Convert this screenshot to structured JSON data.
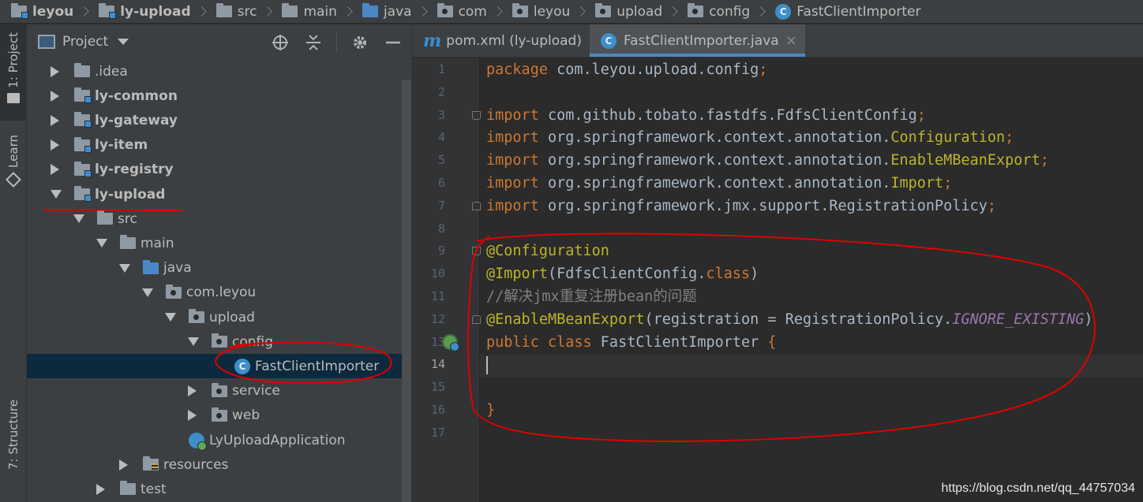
{
  "breadcrumb": [
    {
      "label": "leyou",
      "icon": "module-folder-icon",
      "bold": true
    },
    {
      "label": "ly-upload",
      "icon": "module-folder-icon",
      "bold": true
    },
    {
      "label": "src",
      "icon": "folder-icon",
      "bold": false
    },
    {
      "label": "main",
      "icon": "folder-icon",
      "bold": false
    },
    {
      "label": "java",
      "icon": "source-folder-icon",
      "bold": false
    },
    {
      "label": "com",
      "icon": "package-icon",
      "bold": false
    },
    {
      "label": "leyou",
      "icon": "package-icon",
      "bold": false
    },
    {
      "label": "upload",
      "icon": "package-icon",
      "bold": false
    },
    {
      "label": "config",
      "icon": "package-icon",
      "bold": false
    },
    {
      "label": "FastClientImporter",
      "icon": "class-icon",
      "bold": false
    }
  ],
  "left_strip": {
    "project_tab": "1: Project",
    "learn_tab": "Learn",
    "structure_tab": "7: Structure"
  },
  "project_panel": {
    "title": "Project",
    "tools": [
      "locate-icon",
      "collapse-all-icon",
      "gear-icon",
      "minimize-icon"
    ],
    "tree": [
      {
        "label": ".idea",
        "depth": 0,
        "expanded": false,
        "icon": "folder",
        "bold": false
      },
      {
        "label": "ly-common",
        "depth": 0,
        "expanded": false,
        "icon": "module",
        "bold": true
      },
      {
        "label": "ly-gateway",
        "depth": 0,
        "expanded": false,
        "icon": "module",
        "bold": true
      },
      {
        "label": "ly-item",
        "depth": 0,
        "expanded": false,
        "icon": "module",
        "bold": true
      },
      {
        "label": "ly-registry",
        "depth": 0,
        "expanded": false,
        "icon": "module",
        "bold": true
      },
      {
        "label": "ly-upload",
        "depth": 0,
        "expanded": true,
        "icon": "module",
        "bold": true
      },
      {
        "label": "src",
        "depth": 1,
        "expanded": true,
        "icon": "folder",
        "bold": false
      },
      {
        "label": "main",
        "depth": 2,
        "expanded": true,
        "icon": "folder",
        "bold": false
      },
      {
        "label": "java",
        "depth": 3,
        "expanded": true,
        "icon": "source",
        "bold": false
      },
      {
        "label": "com.leyou",
        "depth": 4,
        "expanded": true,
        "icon": "package",
        "bold": false
      },
      {
        "label": "upload",
        "depth": 5,
        "expanded": true,
        "icon": "package",
        "bold": false
      },
      {
        "label": "config",
        "depth": 6,
        "expanded": true,
        "icon": "package",
        "bold": false
      },
      {
        "label": "FastClientImporter",
        "depth": 7,
        "expanded": null,
        "icon": "class",
        "bold": false,
        "selected": true
      },
      {
        "label": "service",
        "depth": 6,
        "expanded": false,
        "icon": "package",
        "bold": false
      },
      {
        "label": "web",
        "depth": 6,
        "expanded": false,
        "icon": "package",
        "bold": false
      },
      {
        "label": "LyUploadApplication",
        "depth": 5,
        "expanded": null,
        "icon": "app",
        "bold": false
      },
      {
        "label": "resources",
        "depth": 3,
        "expanded": false,
        "icon": "resources",
        "bold": false
      },
      {
        "label": "test",
        "depth": 2,
        "expanded": false,
        "icon": "folder",
        "bold": false
      }
    ]
  },
  "editor": {
    "tabs": [
      {
        "label": "pom.xml (ly-upload)",
        "icon": "maven-icon",
        "active": false
      },
      {
        "label": "FastClientImporter.java",
        "icon": "class-icon",
        "active": true
      }
    ],
    "current_line": 14,
    "lines": [
      {
        "n": "1",
        "tokens": [
          [
            "kw",
            "package "
          ],
          [
            "",
            "com.leyou.upload.config"
          ],
          [
            "kw",
            ";"
          ]
        ]
      },
      {
        "n": "2",
        "tokens": []
      },
      {
        "n": "3",
        "tokens": [
          [
            "kw",
            "import "
          ],
          [
            "",
            "com.github.tobato.fastdfs.FdfsClientConfig"
          ],
          [
            "kw",
            ";"
          ]
        ]
      },
      {
        "n": "4",
        "tokens": [
          [
            "kw",
            "import "
          ],
          [
            "",
            "org.springframework.context.annotation."
          ],
          [
            "an",
            "Configuration"
          ],
          [
            "kw",
            ";"
          ]
        ]
      },
      {
        "n": "5",
        "tokens": [
          [
            "kw",
            "import "
          ],
          [
            "",
            "org.springframework.context.annotation."
          ],
          [
            "an",
            "EnableMBeanExport"
          ],
          [
            "kw",
            ";"
          ]
        ]
      },
      {
        "n": "6",
        "tokens": [
          [
            "kw",
            "import "
          ],
          [
            "",
            "org.springframework.context.annotation."
          ],
          [
            "an",
            "Import"
          ],
          [
            "kw",
            ";"
          ]
        ]
      },
      {
        "n": "7",
        "tokens": [
          [
            "kw",
            "import "
          ],
          [
            "",
            "org.springframework.jmx.support.RegistrationPolicy"
          ],
          [
            "kw",
            ";"
          ]
        ]
      },
      {
        "n": "8",
        "tokens": []
      },
      {
        "n": "9",
        "tokens": [
          [
            "an",
            "@Configuration"
          ]
        ]
      },
      {
        "n": "10",
        "tokens": [
          [
            "an",
            "@Import"
          ],
          [
            "",
            "(FdfsClientConfig."
          ],
          [
            "kw",
            "class"
          ],
          [
            "",
            ")"
          ]
        ]
      },
      {
        "n": "11",
        "tokens": [
          [
            "cm",
            "//解决jmx重复注册bean的问题"
          ]
        ]
      },
      {
        "n": "12",
        "tokens": [
          [
            "an",
            "@EnableMBeanExport"
          ],
          [
            "",
            "(registration = RegistrationPolicy."
          ],
          [
            "st",
            "IGNORE_EXISTING"
          ],
          [
            "",
            ")"
          ]
        ]
      },
      {
        "n": "13",
        "tokens": [
          [
            "kw",
            "public class "
          ],
          [
            "",
            "FastClientImporter "
          ],
          [
            "kw",
            "{"
          ]
        ]
      },
      {
        "n": "14",
        "tokens": []
      },
      {
        "n": "15",
        "tokens": []
      },
      {
        "n": "16",
        "tokens": [
          [
            "kw",
            "}"
          ]
        ]
      },
      {
        "n": "17",
        "tokens": []
      }
    ]
  },
  "watermark": "https://blog.csdn.net/qq_44757034",
  "colors": {
    "keyword": "#cc7832",
    "annotation": "#bbb529",
    "comment": "#808080",
    "static_field": "#9876aa",
    "plain": "#a9b7c6",
    "annotation_marker": "#e00000"
  }
}
